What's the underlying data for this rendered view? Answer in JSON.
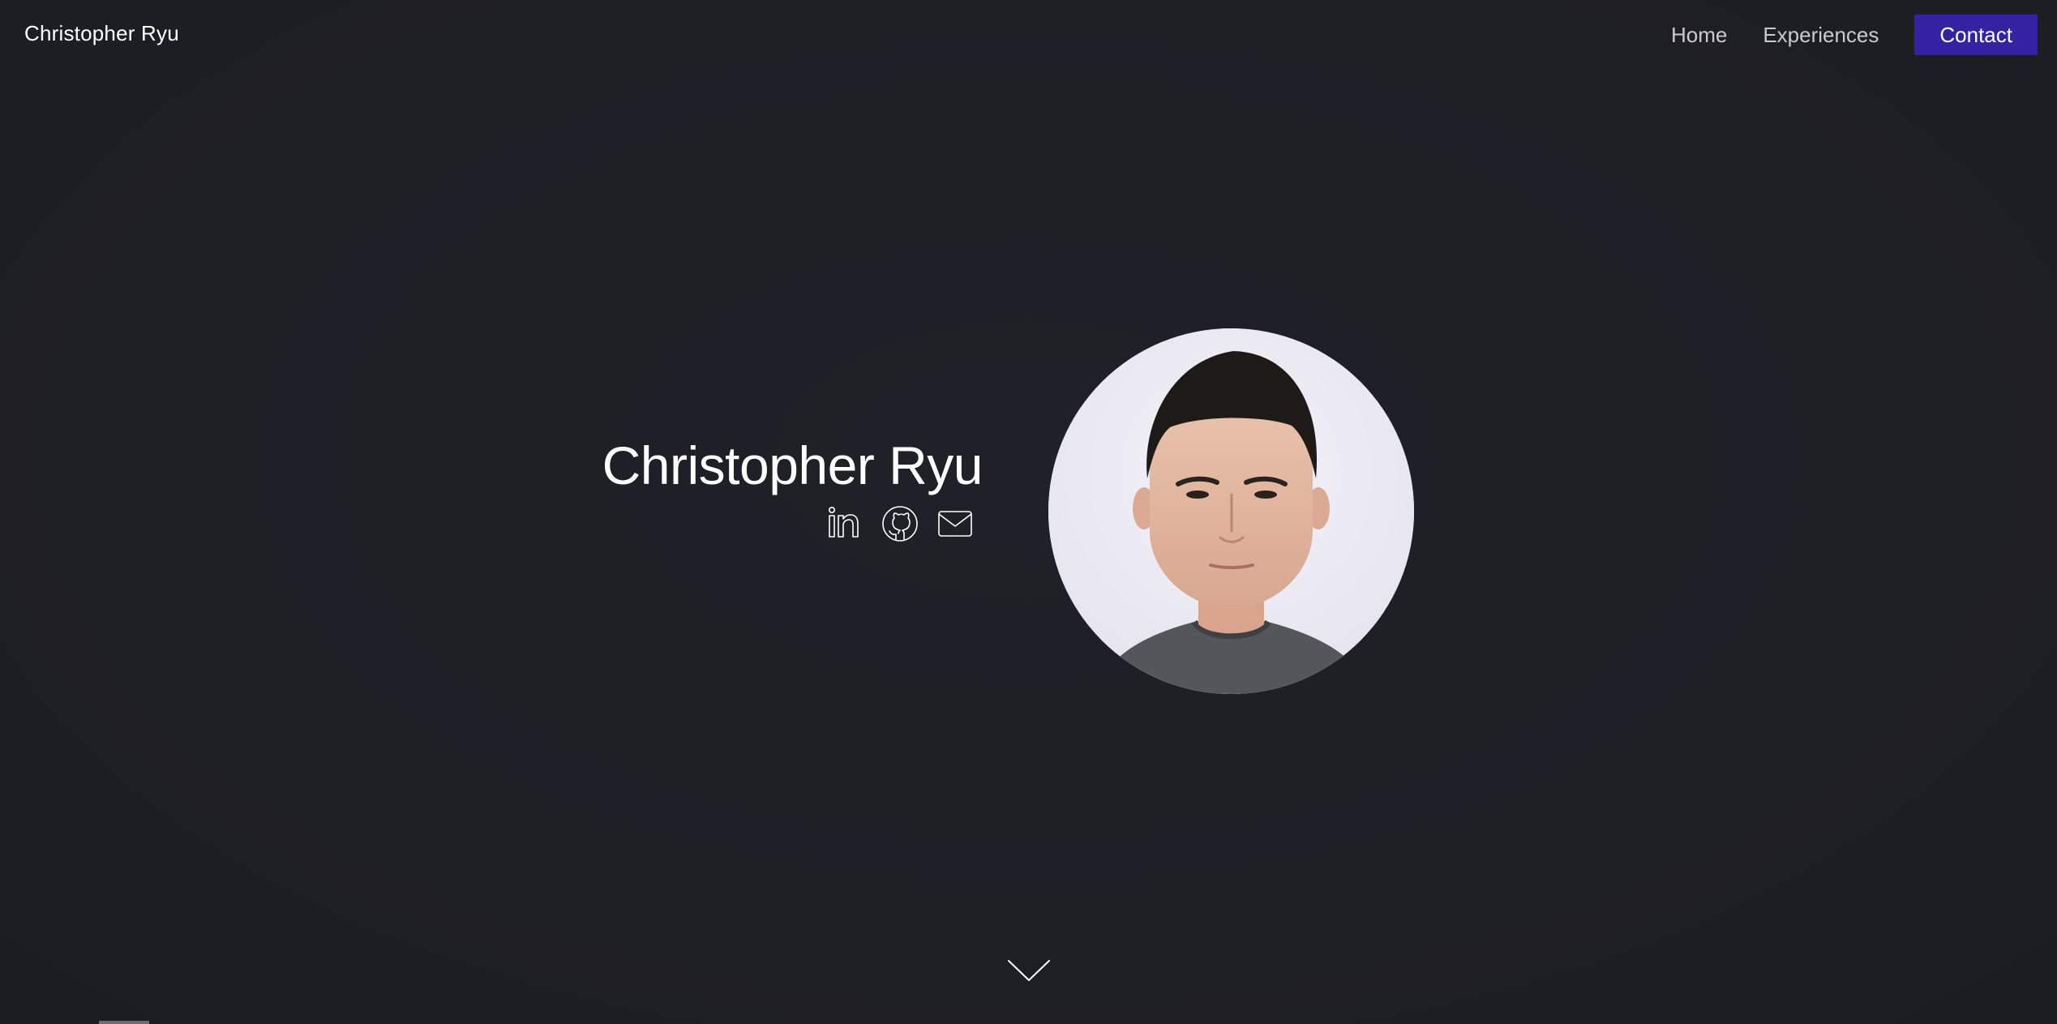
{
  "header": {
    "brand": "Christopher Ryu",
    "nav": [
      {
        "label": "Home"
      },
      {
        "label": "Experiences"
      }
    ],
    "contact_label": "Contact"
  },
  "hero": {
    "name": "Christopher Ryu",
    "socials": [
      {
        "icon": "linkedin-icon"
      },
      {
        "icon": "github-icon"
      },
      {
        "icon": "mail-icon"
      }
    ],
    "avatar": "profile-photo"
  },
  "colors": {
    "background": "#1f2026",
    "accent": "#3323a3",
    "nav_text": "#c9cad1"
  }
}
